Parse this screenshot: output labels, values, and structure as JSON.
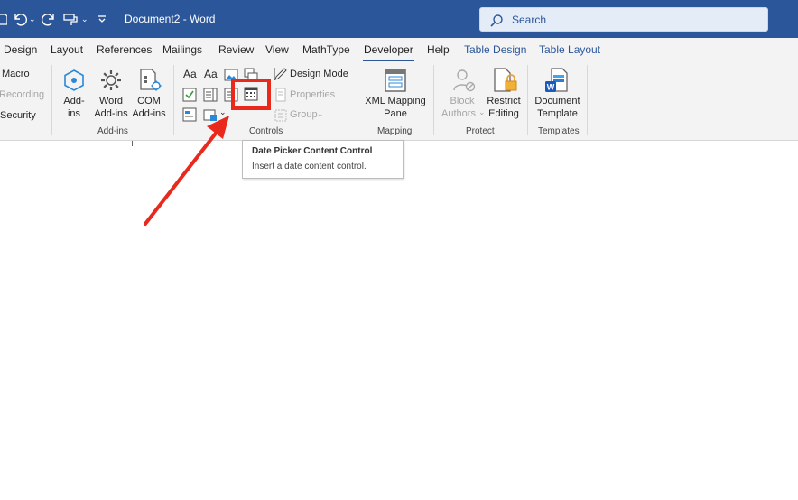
{
  "titlebar": {
    "document_title": "Document2  -  Word",
    "search_placeholder": "Search"
  },
  "tabs": [
    {
      "label": "Design"
    },
    {
      "label": "Layout"
    },
    {
      "label": "References"
    },
    {
      "label": "Mailings"
    },
    {
      "label": "Review"
    },
    {
      "label": "View"
    },
    {
      "label": "MathType"
    },
    {
      "label": "Developer",
      "active": true
    },
    {
      "label": "Help"
    },
    {
      "label": "Table Design",
      "contextual": true
    },
    {
      "label": "Table Layout",
      "contextual": true
    }
  ],
  "ribbon": {
    "code": {
      "macro": "Macro",
      "recording": "Recording",
      "security": "Security"
    },
    "addins": {
      "addins_line1": "Add-",
      "addins_line2": "ins",
      "word_line1": "Word",
      "word_line2": "Add-ins",
      "com_line1": "COM",
      "com_line2": "Add-ins",
      "group_label": "Add-ins"
    },
    "controls": {
      "rich_text": "Aa",
      "plain_text": "Aa",
      "design_mode": "Design Mode",
      "properties": "Properties",
      "group": "Group",
      "group_label": "Controls"
    },
    "mapping": {
      "xml_line1": "XML Mapping",
      "xml_line2": "Pane",
      "group_label": "Mapping"
    },
    "protect": {
      "block_line1": "Block",
      "block_line2": "Authors",
      "restrict_line1": "Restrict",
      "restrict_line2": "Editing",
      "group_label": "Protect"
    },
    "templates": {
      "doc_line1": "Document",
      "doc_line2": "Template",
      "group_label": "Templates"
    }
  },
  "tooltip": {
    "title": "Date Picker Content Control",
    "description": "Insert a date content control."
  },
  "colors": {
    "titlebar": "#2b579a",
    "annotation_red": "#e8291c",
    "ribbon_bg": "#f3f3f3"
  }
}
